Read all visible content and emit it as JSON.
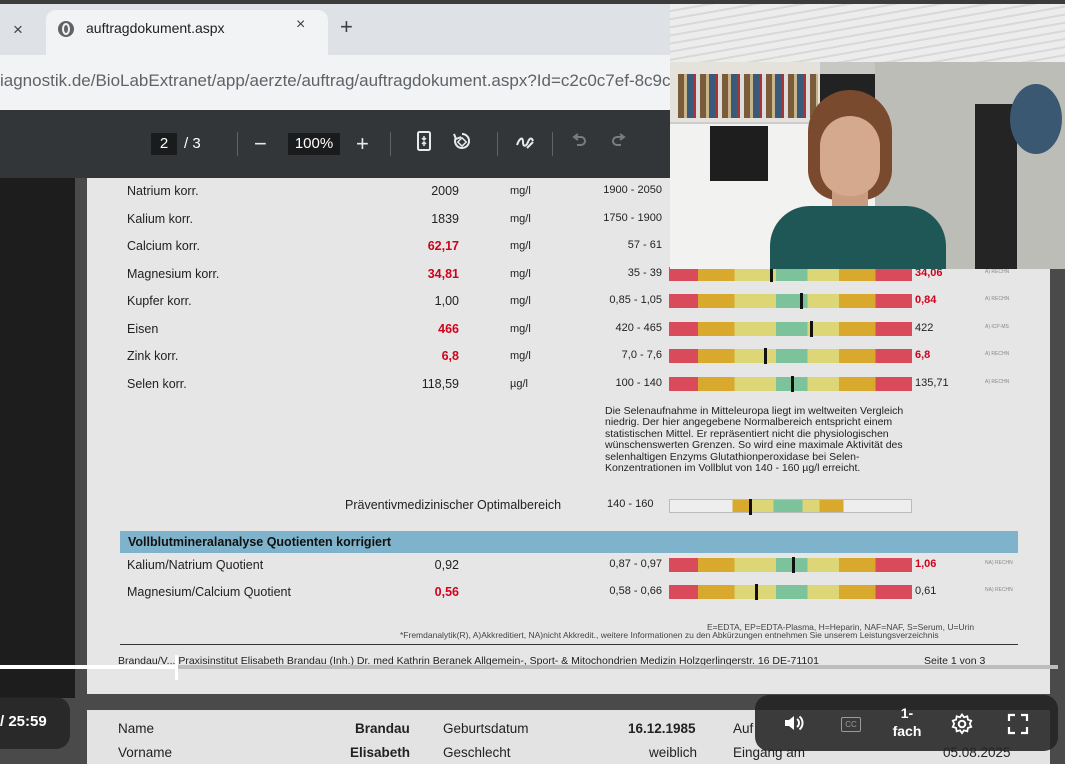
{
  "browser": {
    "prev_tab_close": "×",
    "tab_title": "auftragdokument.aspx",
    "tab_close": "×",
    "new_tab": "+",
    "url": "iagnostik.de/BioLabExtranet/app/aerzte/auftrag/auftragdokument.aspx?Id=c2c0c7ef-8c9c"
  },
  "pdf_toolbar": {
    "page_current": "2",
    "page_total": "/ 3",
    "zoom_out": "−",
    "zoom": "100%",
    "zoom_in": "+",
    "fit_icon": "fit-page-icon",
    "rotate_icon": "rotate-icon",
    "annotate_icon": "draw-icon",
    "undo_icon": "undo-icon",
    "redo_icon": "redo-icon"
  },
  "results": [
    {
      "name": "Natrium korr.",
      "value": "2009",
      "red": false,
      "unit": "mg/l",
      "range": "1900 - 2050",
      "ref": "",
      "ref_red": false,
      "marker": null,
      "acc": ""
    },
    {
      "name": "Kalium korr.",
      "value": "1839",
      "red": false,
      "unit": "mg/l",
      "range": "1750 - 1900",
      "ref": "",
      "ref_red": false,
      "marker": null,
      "acc": ""
    },
    {
      "name": "Calcium korr.",
      "value": "62,17",
      "red": true,
      "unit": "mg/l",
      "range": "57 - 61",
      "ref": "",
      "ref_red": false,
      "marker": null,
      "acc": ""
    },
    {
      "name": "Magnesium korr.",
      "value": "34,81",
      "red": true,
      "unit": "mg/l",
      "range": "35 - 39",
      "ref": "34,06",
      "ref_red": true,
      "marker": 0.42,
      "acc": "A) RECHN"
    },
    {
      "name": "Kupfer korr.",
      "value": "1,00",
      "red": false,
      "unit": "mg/l",
      "range": "0,85 - 1,05",
      "ref": "0,84",
      "ref_red": true,
      "marker": 0.545,
      "acc": "A) RECHN"
    },
    {
      "name": "Eisen",
      "value": "466",
      "red": true,
      "unit": "mg/l",
      "range": "420 - 465",
      "ref": "422",
      "ref_red": false,
      "marker": 0.585,
      "acc": "A) ICP-MS"
    },
    {
      "name": "Zink korr.",
      "value": "6,8",
      "red": true,
      "unit": "mg/l",
      "range": "7,0 - 7,6",
      "ref": "6,8",
      "ref_red": true,
      "marker": 0.395,
      "acc": "A) RECHN"
    },
    {
      "name": "Selen korr.",
      "value": "118,59",
      "red": false,
      "unit": "µg/l",
      "range": "100 - 140",
      "ref": "135,71",
      "ref_red": false,
      "marker": 0.505,
      "acc": "A) RECHN"
    }
  ],
  "selen_note": "Die Selenaufnahme in Mitteleuropa liegt im weltweiten Vergleich niedrig. Der hier angegebene Normalbereich entspricht einem statistischen Mittel. Er repräsentiert nicht die physiologischen wünschenswerten Grenzen. So wird eine maximale Aktivität des selenhaltigen Enzyms Glutathionperoxidase bei Selen-Konzentrationen im Vollblut von 140 - 160 µg/l erreicht.",
  "optimal": {
    "label": "Präventivmedizinischer Optimalbereich",
    "range": "140 - 160",
    "marker": 0.33
  },
  "section_title": "Vollblutmineralanalyse Quotienten korrigiert",
  "quotients": [
    {
      "name": "Kalium/Natrium Quotient",
      "value": "0,92",
      "red": false,
      "range": "0,87 - 0,97",
      "ref": "1,06",
      "ref_red": true,
      "marker": 0.51,
      "acc": "NA) RECHN"
    },
    {
      "name": "Magnesium/Calcium Quotient",
      "value": "0,56",
      "red": true,
      "range": "0,58 - 0,66",
      "ref": "0,61",
      "ref_red": false,
      "marker": 0.36,
      "acc": "NA) RECHN"
    }
  ],
  "legend_line1": "E=EDTA, EP=EDTA-Plasma, H=Heparin, NAF=NAF, S=Serum, U=Urin",
  "legend_line2": "*Fremdanalytik(R), A)Akkreditiert, NA)nicht Akkredit., weitere Informationen zu den Abkürzungen entnehmen Sie unserem Leistungsverzeichnis",
  "footer": "Brandau/V... Praxisinstitut Elisabeth Brandau (Inh.) Dr. med Kathrin Beranek Allgemein-, Sport- & Mitochondrien Medizin Holzgerlingerstr. 16   DE-71101",
  "page_note": "Seite 1 von 3",
  "page2": {
    "name_label": "Name",
    "name_value": "Brandau",
    "birth_label": "Geburtsdatum",
    "birth_value": "16.12.1985",
    "auf_label": "Auf",
    "first_label": "Vorname",
    "first_value": "Elisabeth",
    "sex_label": "Geschlecht",
    "sex_value": "weiblich",
    "entry_label": "Eingang am",
    "entry_value": "05.08.2025"
  },
  "video": {
    "time": "/ 25:59",
    "progress_fraction": 0.166,
    "volume_icon": "volume-icon",
    "cc_label": "CC",
    "speed_line1": "1-",
    "speed_line2": "fach",
    "settings_icon": "gear-icon",
    "fullscreen_icon": "fullscreen-icon"
  }
}
